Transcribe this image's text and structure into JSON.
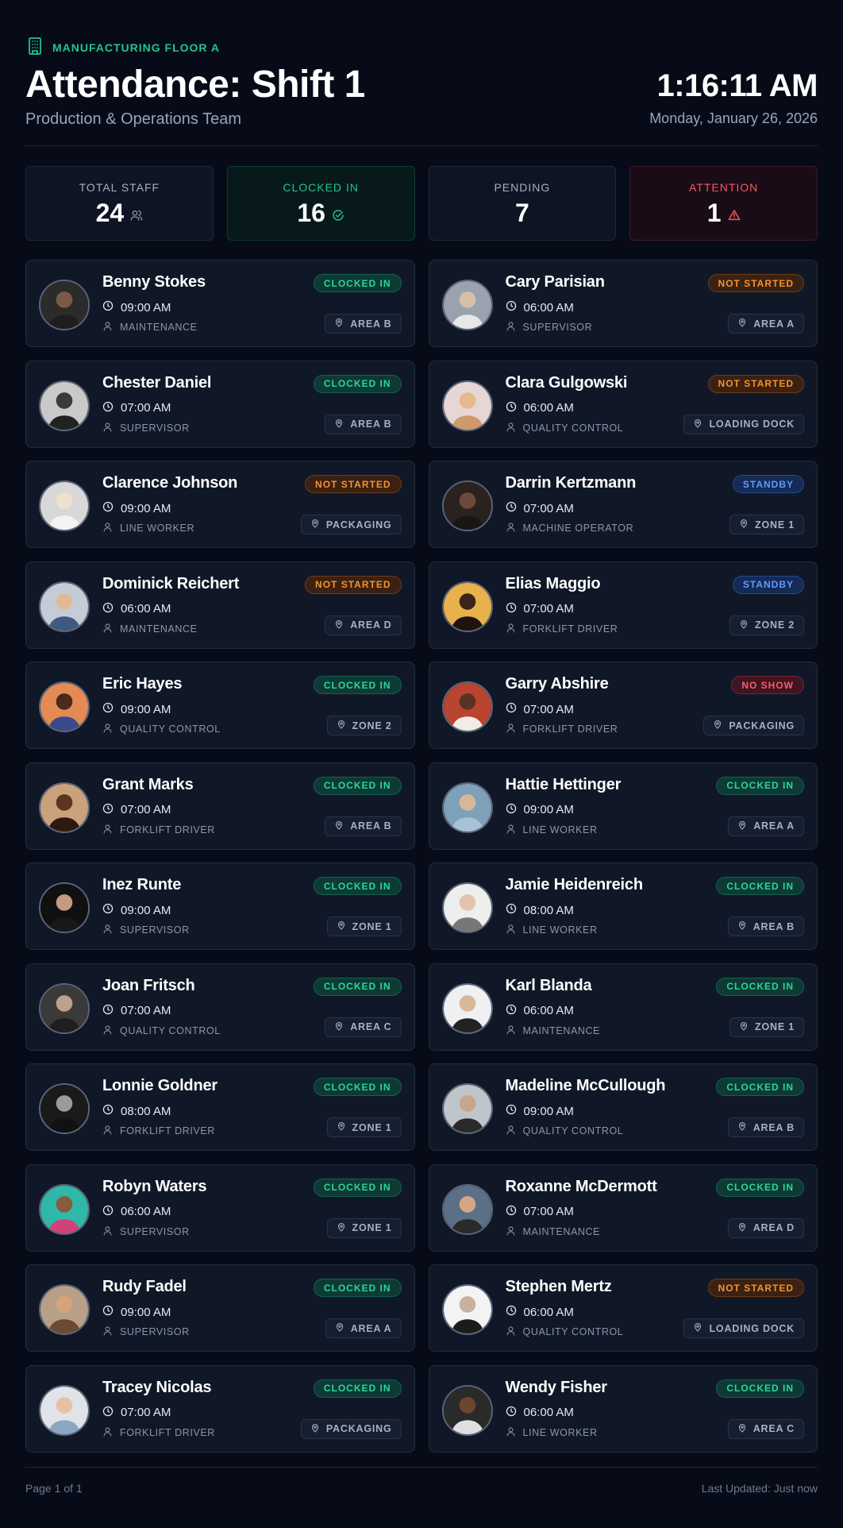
{
  "header": {
    "kicker": "MANUFACTURING FLOOR A",
    "kicker_icon": "building-icon",
    "title": "Attendance: Shift 1",
    "subtitle": "Production & Operations Team",
    "time": "1:16:11 AM",
    "date": "Monday, January 26, 2026"
  },
  "colors": {
    "background": "#070b18",
    "clocked_in": "#2ad69a",
    "not_started": "#f7922e",
    "standby": "#5d9cff",
    "no_show": "#ff5a6a",
    "attention": "#f0595f"
  },
  "stats": [
    {
      "label": "TOTAL STAFF",
      "value": "24",
      "icon": "users-icon",
      "kind": "total"
    },
    {
      "label": "CLOCKED IN",
      "value": "16",
      "icon": "check-circle-icon",
      "kind": "clocked"
    },
    {
      "label": "PENDING",
      "value": "7",
      "icon": "",
      "kind": "pending"
    },
    {
      "label": "ATTENTION",
      "value": "1",
      "icon": "warning-icon",
      "kind": "attention"
    }
  ],
  "staff": [
    {
      "name": "Benny Stokes",
      "time": "09:00 AM",
      "role": "MAINTENANCE",
      "status": "CLOCKED IN",
      "location": "AREA B"
    },
    {
      "name": "Cary Parisian",
      "time": "06:00 AM",
      "role": "SUPERVISOR",
      "status": "NOT STARTED",
      "location": "AREA A"
    },
    {
      "name": "Chester Daniel",
      "time": "07:00 AM",
      "role": "SUPERVISOR",
      "status": "CLOCKED IN",
      "location": "AREA B"
    },
    {
      "name": "Clara Gulgowski",
      "time": "06:00 AM",
      "role": "QUALITY CONTROL",
      "status": "NOT STARTED",
      "location": "LOADING DOCK"
    },
    {
      "name": "Clarence Johnson",
      "time": "09:00 AM",
      "role": "LINE WORKER",
      "status": "NOT STARTED",
      "location": "PACKAGING"
    },
    {
      "name": "Darrin Kertzmann",
      "time": "07:00 AM",
      "role": "MACHINE OPERATOR",
      "status": "STANDBY",
      "location": "ZONE 1"
    },
    {
      "name": "Dominick Reichert",
      "time": "06:00 AM",
      "role": "MAINTENANCE",
      "status": "NOT STARTED",
      "location": "AREA D"
    },
    {
      "name": "Elias Maggio",
      "time": "07:00 AM",
      "role": "FORKLIFT DRIVER",
      "status": "STANDBY",
      "location": "ZONE 2"
    },
    {
      "name": "Eric Hayes",
      "time": "09:00 AM",
      "role": "QUALITY CONTROL",
      "status": "CLOCKED IN",
      "location": "ZONE 2"
    },
    {
      "name": "Garry Abshire",
      "time": "07:00 AM",
      "role": "FORKLIFT DRIVER",
      "status": "NO SHOW",
      "location": "PACKAGING"
    },
    {
      "name": "Grant Marks",
      "time": "07:00 AM",
      "role": "FORKLIFT DRIVER",
      "status": "CLOCKED IN",
      "location": "AREA B"
    },
    {
      "name": "Hattie Hettinger",
      "time": "09:00 AM",
      "role": "LINE WORKER",
      "status": "CLOCKED IN",
      "location": "AREA A"
    },
    {
      "name": "Inez Runte",
      "time": "09:00 AM",
      "role": "SUPERVISOR",
      "status": "CLOCKED IN",
      "location": "ZONE 1"
    },
    {
      "name": "Jamie Heidenreich",
      "time": "08:00 AM",
      "role": "LINE WORKER",
      "status": "CLOCKED IN",
      "location": "AREA B"
    },
    {
      "name": "Joan Fritsch",
      "time": "07:00 AM",
      "role": "QUALITY CONTROL",
      "status": "CLOCKED IN",
      "location": "AREA C"
    },
    {
      "name": "Karl Blanda",
      "time": "06:00 AM",
      "role": "MAINTENANCE",
      "status": "CLOCKED IN",
      "location": "ZONE 1"
    },
    {
      "name": "Lonnie Goldner",
      "time": "08:00 AM",
      "role": "FORKLIFT DRIVER",
      "status": "CLOCKED IN",
      "location": "ZONE 1"
    },
    {
      "name": "Madeline McCullough",
      "time": "09:00 AM",
      "role": "QUALITY CONTROL",
      "status": "CLOCKED IN",
      "location": "AREA B"
    },
    {
      "name": "Robyn Waters",
      "time": "06:00 AM",
      "role": "SUPERVISOR",
      "status": "CLOCKED IN",
      "location": "ZONE 1"
    },
    {
      "name": "Roxanne McDermott",
      "time": "07:00 AM",
      "role": "MAINTENANCE",
      "status": "CLOCKED IN",
      "location": "AREA D"
    },
    {
      "name": "Rudy Fadel",
      "time": "09:00 AM",
      "role": "SUPERVISOR",
      "status": "CLOCKED IN",
      "location": "AREA A"
    },
    {
      "name": "Stephen Mertz",
      "time": "06:00 AM",
      "role": "QUALITY CONTROL",
      "status": "NOT STARTED",
      "location": "LOADING DOCK"
    },
    {
      "name": "Tracey Nicolas",
      "time": "07:00 AM",
      "role": "FORKLIFT DRIVER",
      "status": "CLOCKED IN",
      "location": "PACKAGING"
    },
    {
      "name": "Wendy Fisher",
      "time": "06:00 AM",
      "role": "LINE WORKER",
      "status": "CLOCKED IN",
      "location": "AREA C"
    }
  ],
  "footer": {
    "page": "Page 1 of 1",
    "updated": "Last Updated: Just now"
  }
}
